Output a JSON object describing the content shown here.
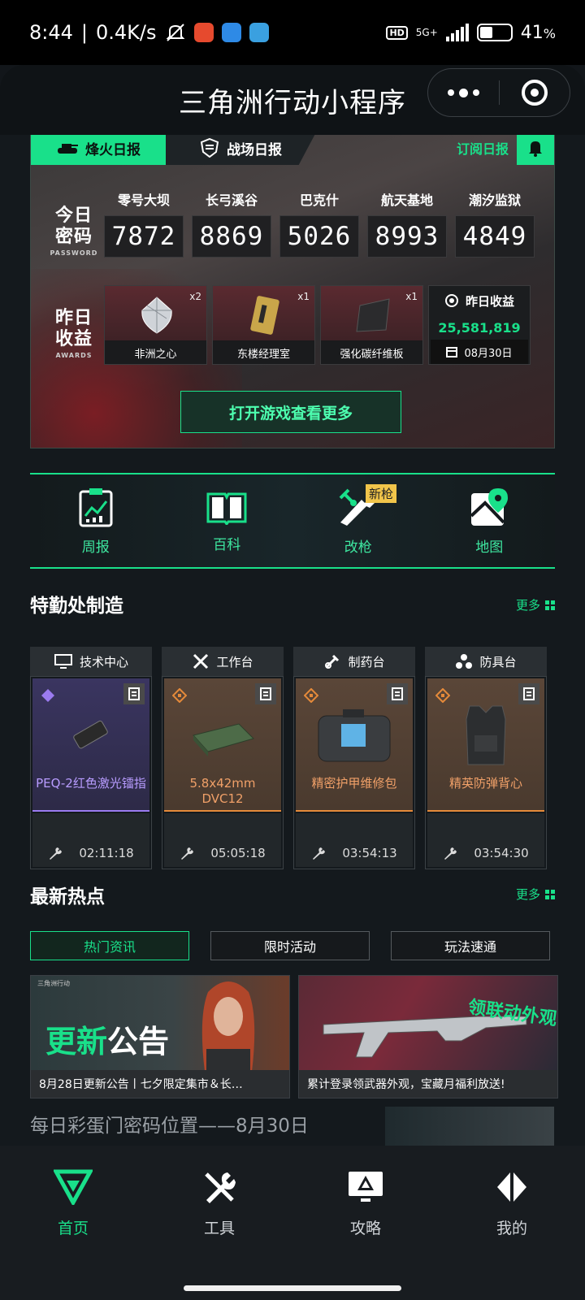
{
  "status_bar": {
    "time": "8:44",
    "net_speed": "0.4K/s",
    "network": "5G+",
    "battery": "41",
    "battery_level": 0.41
  },
  "titlebar": {
    "title": "三角洲行动小程序"
  },
  "daily_tabs": {
    "fire": "烽火日报",
    "battle": "战场日报",
    "subscribe": "订阅日报"
  },
  "password_section": {
    "label": "今日密码",
    "label_en": "PASSWORD",
    "maps": [
      {
        "name": "零号大坝",
        "code": "7872"
      },
      {
        "name": "长弓溪谷",
        "code": "8869"
      },
      {
        "name": "巴克什",
        "code": "5026"
      },
      {
        "name": "航天基地",
        "code": "8993"
      },
      {
        "name": "潮汐监狱",
        "code": "4849"
      }
    ]
  },
  "awards_section": {
    "label": "昨日收益",
    "label_en": "AWARDS",
    "items": [
      {
        "name": "非洲之心",
        "qty": "x2"
      },
      {
        "name": "东楼经理室",
        "qty": "x1"
      },
      {
        "name": "强化碳纤维板",
        "qty": "x1"
      }
    ],
    "income": {
      "label": "昨日收益",
      "value": "25,581,819",
      "date": "08月30日"
    }
  },
  "open_game_button": "打开游戏查看更多",
  "tools": [
    {
      "label": "周报",
      "icon": "report-chart-icon"
    },
    {
      "label": "百科",
      "icon": "book-icon"
    },
    {
      "label": "改枪",
      "icon": "gun-wrench-icon",
      "badge": "新枪"
    },
    {
      "label": "地图",
      "icon": "map-pin-icon"
    }
  ],
  "crafting": {
    "title": "特勤处制造",
    "more": "更多",
    "stations": [
      {
        "station": "技术中心",
        "item": "PEQ-2红色激光镭指",
        "time": "02:11:18",
        "rarity": "purple"
      },
      {
        "station": "工作台",
        "item": "5.8x42mm DVC12",
        "time": "05:05:18",
        "rarity": "orange"
      },
      {
        "station": "制药台",
        "item": "精密护甲维修包",
        "time": "03:54:13",
        "rarity": "orange"
      },
      {
        "station": "防具台",
        "item": "精英防弹背心",
        "time": "03:54:30",
        "rarity": "orange"
      }
    ]
  },
  "hot_news": {
    "title": "最新热点",
    "more": "更多",
    "tabs": [
      "热门资讯",
      "限时活动",
      "玩法速通"
    ],
    "cards": [
      {
        "caption": "8月28日更新公告丨七夕限定集市＆长…",
        "banner_a": "更新",
        "banner_b": "公告",
        "logo": "三角洲行动"
      },
      {
        "caption": "累计登录领武器外观，宝藏月福利放送!",
        "banner": "领联动外观"
      }
    ],
    "article_title": "每日彩蛋门密码位置——8月30日"
  },
  "bottom_nav": [
    {
      "label": "首页",
      "icon": "home-logo-icon",
      "active": true
    },
    {
      "label": "工具",
      "icon": "tools-icon",
      "active": false
    },
    {
      "label": "攻略",
      "icon": "guide-monitor-icon",
      "active": false
    },
    {
      "label": "我的",
      "icon": "profile-icon",
      "active": false
    }
  ],
  "colors": {
    "accent": "#19e08a",
    "background": "#14191d",
    "purple_rarity": "#9b7bf0",
    "orange_rarity": "#e58a3a"
  }
}
